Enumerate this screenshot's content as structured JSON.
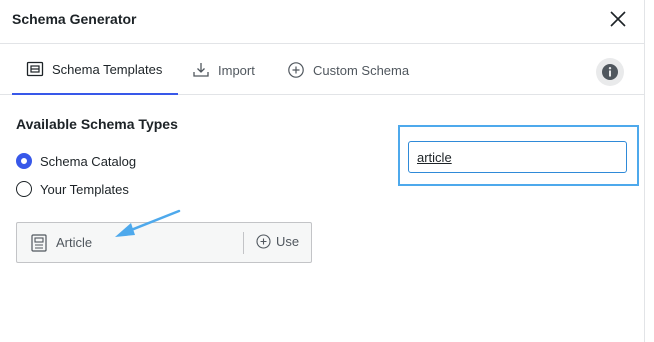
{
  "header": {
    "title": "Schema Generator",
    "close_icon": "close-icon"
  },
  "tabs": [
    {
      "label": "Schema Templates",
      "icon": "templates-icon",
      "active": true
    },
    {
      "label": "Import",
      "icon": "import-icon",
      "active": false
    },
    {
      "label": "Custom Schema",
      "icon": "plus-circle-icon",
      "active": false
    }
  ],
  "info_icon": "info-icon",
  "section": {
    "title": "Available Schema Types",
    "options": [
      {
        "label": "Schema Catalog",
        "checked": true
      },
      {
        "label": "Your Templates",
        "checked": false
      }
    ]
  },
  "search": {
    "value": "article"
  },
  "templates": [
    {
      "label": "Article",
      "icon": "document-icon",
      "action_label": "Use",
      "action_icon": "plus-circle-icon"
    }
  ],
  "colors": {
    "accent": "#3858e9",
    "highlight": "#4ea9ec",
    "annotation_arrow": "#4ea9ec"
  }
}
